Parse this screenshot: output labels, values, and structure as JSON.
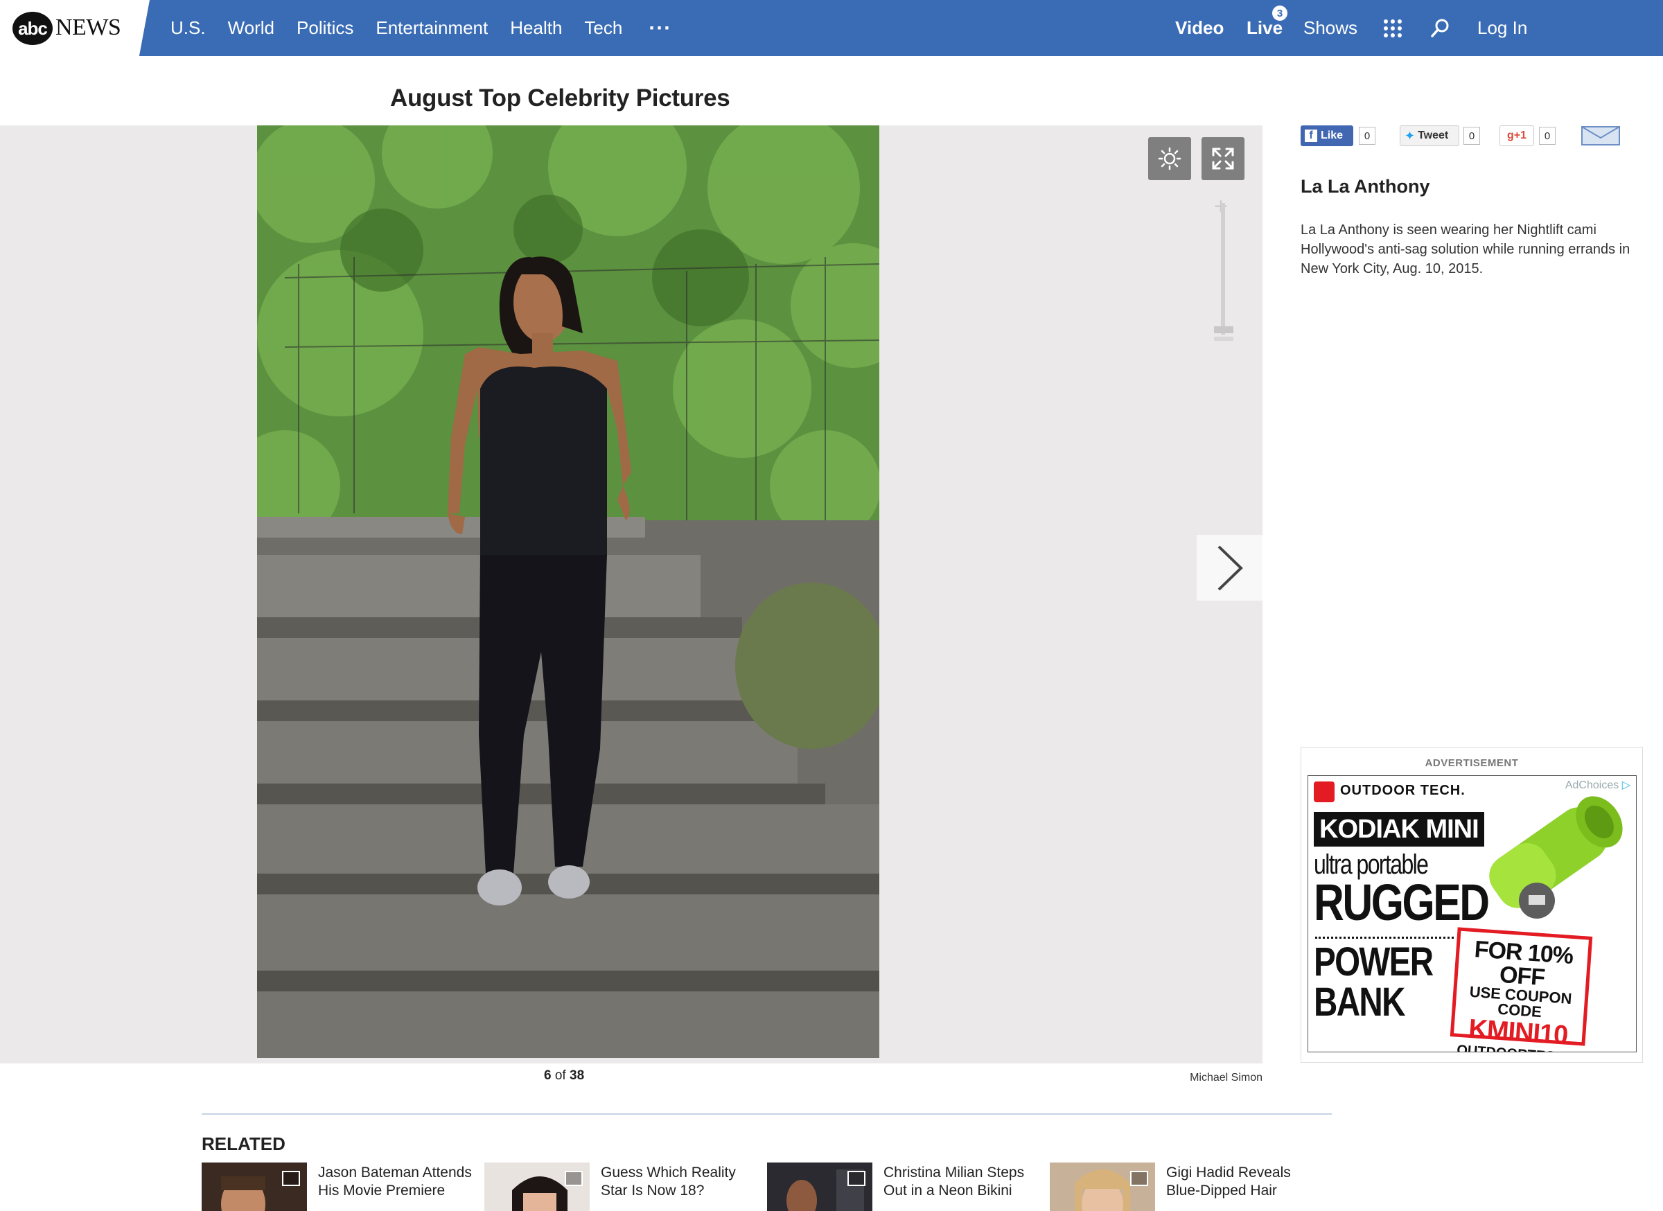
{
  "nav": {
    "logo_abc": "abc",
    "logo_news": "NEWS",
    "items": [
      "U.S.",
      "World",
      "Politics",
      "Entertainment",
      "Health",
      "Tech"
    ],
    "more": "···",
    "video": "Video",
    "live": "Live",
    "live_count": "3",
    "shows": "Shows",
    "login": "Log In",
    "bar_color": "#3a6cb5"
  },
  "gallery": {
    "title": "August Top Celebrity Pictures",
    "current": "6",
    "of": "of",
    "total": "38",
    "credit": "Michael Simon"
  },
  "sidebar": {
    "share": {
      "like_label": "Like",
      "like_count": "0",
      "tweet_label": "Tweet",
      "tweet_count": "0",
      "gplus_label": "g+1",
      "gplus_count": "0"
    },
    "photo_title": "La La Anthony",
    "photo_caption": "La La Anthony is seen wearing her Nightlift cami Hollywood's anti-sag solution while running errands in New York City, Aug. 10, 2015.",
    "ad": {
      "label": "ADVERTISEMENT",
      "adchoices": "AdChoices",
      "brand": "OUTDOOR TECH.",
      "line1": "KODIAK MINI",
      "line2": "ultra portable",
      "line3": "RUGGED",
      "line4": "POWER",
      "line5": "BANK",
      "coupon1": "FOR 10% OFF",
      "coupon2": "USE COUPON CODE",
      "coupon3": "KMINI10",
      "coupon4": "OUTDOORTECH.COM"
    }
  },
  "related": {
    "title": "RELATED",
    "items": [
      {
        "title": "Jason Bateman Attends His Movie Premiere"
      },
      {
        "title": "Guess Which Reality Star Is Now 18?"
      },
      {
        "title": "Christina Milian Steps Out in a Neon Bikini"
      },
      {
        "title": "Gigi Hadid Reveals Blue-Dipped Hair"
      }
    ]
  }
}
